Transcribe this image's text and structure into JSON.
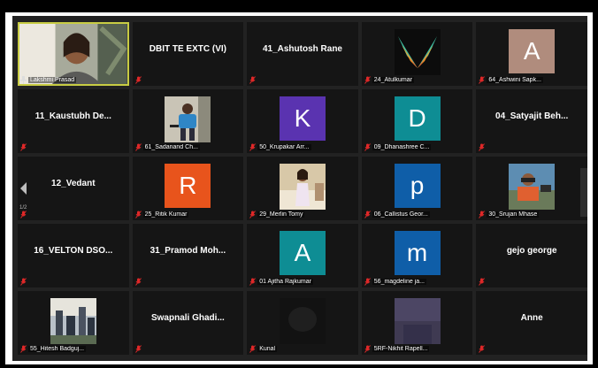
{
  "participants": [
    {
      "label": "Lakshmi Prasad",
      "display": "",
      "type": "video",
      "active": true,
      "mic": "pin"
    },
    {
      "label": "",
      "display": "DBIT TE EXTC (VI)",
      "type": "name",
      "mic": "muted"
    },
    {
      "label": "",
      "display": "41_Ashutosh Rane",
      "type": "name",
      "mic": "muted"
    },
    {
      "label": "24_Atulkumar",
      "display": "",
      "type": "photo-wings",
      "mic": "muted"
    },
    {
      "label": "64_Ashwini Sapk...",
      "display": "",
      "type": "letter",
      "letter": "A",
      "color": "#b08c7d",
      "mic": "muted"
    },
    {
      "label": "",
      "display": "11_Kaustubh De...",
      "type": "name",
      "mic": "muted"
    },
    {
      "label": "61_Sadanand Ch...",
      "display": "",
      "type": "photo-person-blue",
      "mic": "muted"
    },
    {
      "label": "50_Krupakar Arr...",
      "display": "",
      "type": "letter",
      "letter": "K",
      "color": "#5a33b0",
      "mic": "muted"
    },
    {
      "label": "09_Dhanashree C...",
      "display": "",
      "type": "letter",
      "letter": "D",
      "color": "#0e8d94",
      "mic": "muted"
    },
    {
      "label": "",
      "display": "04_Satyajit Beh...",
      "type": "name",
      "mic": "muted"
    },
    {
      "label": "",
      "display": "12_Vedant",
      "type": "name",
      "mic": "muted"
    },
    {
      "label": "25_Ritik Kumar",
      "display": "",
      "type": "letter",
      "letter": "R",
      "color": "#e8541c",
      "mic": "muted"
    },
    {
      "label": "29_Merlin Tomy",
      "display": "",
      "type": "photo-girl",
      "mic": "muted"
    },
    {
      "label": "06_Callistus Geor...",
      "display": "",
      "type": "letter",
      "letter": "p",
      "color": "#0f5ea8",
      "mic": "muted"
    },
    {
      "label": "30_Srujan Mhase",
      "display": "",
      "type": "photo-outdoor",
      "mic": "muted"
    },
    {
      "label": "",
      "display": "16_VELTON  DSO...",
      "type": "name",
      "mic": "muted"
    },
    {
      "label": "",
      "display": "31_Pramod  Moh...",
      "type": "name",
      "mic": "muted"
    },
    {
      "label": "01 Ajitha Rajkumar",
      "display": "",
      "type": "letter",
      "letter": "A",
      "color": "#0e8d94",
      "mic": "muted"
    },
    {
      "label": "56_magdeline ja...",
      "display": "",
      "type": "letter",
      "letter": "m",
      "color": "#0f5ea8",
      "mic": "muted"
    },
    {
      "label": "",
      "display": "gejo george",
      "type": "name",
      "mic": "muted"
    },
    {
      "label": "55_Hitesh Badguj...",
      "display": "",
      "type": "photo-city",
      "mic": "muted"
    },
    {
      "label": "",
      "display": "Swapnali  Ghadi...",
      "type": "name",
      "mic": "muted"
    },
    {
      "label": "Kunal",
      "display": "",
      "type": "photo-dark",
      "mic": "muted"
    },
    {
      "label": "5RF-Nikhit Rapell...",
      "display": "",
      "type": "photo-purple",
      "mic": "muted"
    },
    {
      "label": "",
      "display": "Anne",
      "type": "name",
      "mic": "muted"
    }
  ],
  "pager": {
    "indicator": "1/2"
  }
}
